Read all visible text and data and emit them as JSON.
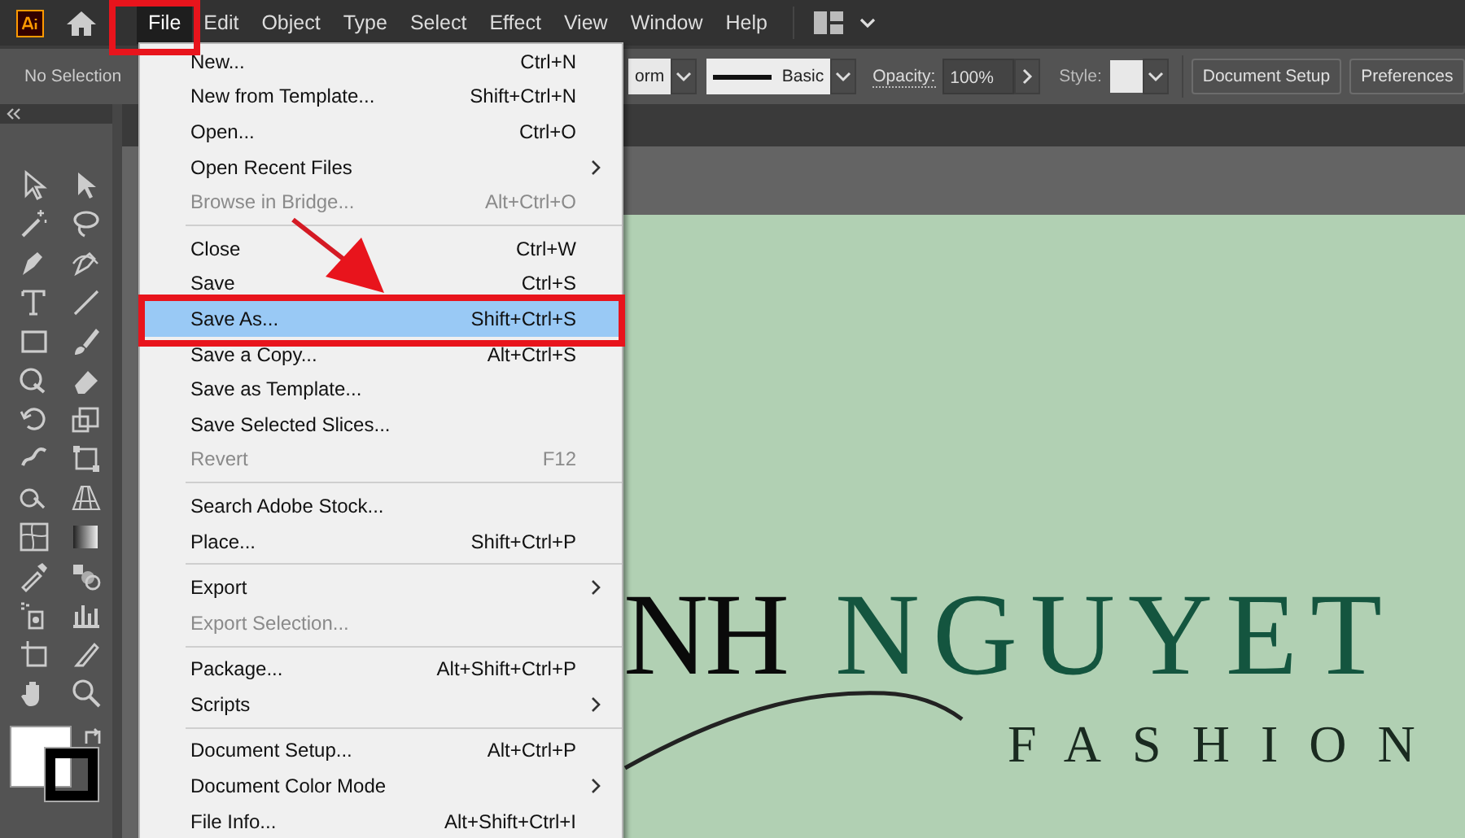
{
  "menubar": {
    "items": [
      {
        "label": "File",
        "selected": true
      },
      {
        "label": "Edit",
        "selected": false
      },
      {
        "label": "Object",
        "selected": false
      },
      {
        "label": "Type",
        "selected": false
      },
      {
        "label": "Select",
        "selected": false
      },
      {
        "label": "Effect",
        "selected": false
      },
      {
        "label": "View",
        "selected": false
      },
      {
        "label": "Window",
        "selected": false
      },
      {
        "label": "Help",
        "selected": false
      }
    ]
  },
  "control_bar": {
    "selection_label": "No Selection",
    "profile_value": "orm",
    "stroke_label": "Basic",
    "opacity_label": "Opacity:",
    "opacity_value": "100%",
    "style_label": "Style:",
    "buttons": [
      "Document Setup",
      "Preferences"
    ]
  },
  "file_menu": {
    "items": [
      {
        "kind": "item",
        "label": "New...",
        "shortcut": "Ctrl+N",
        "submenu": false,
        "disabled": false,
        "selected": false
      },
      {
        "kind": "item",
        "label": "New from Template...",
        "shortcut": "Shift+Ctrl+N",
        "submenu": false,
        "disabled": false,
        "selected": false
      },
      {
        "kind": "item",
        "label": "Open...",
        "shortcut": "Ctrl+O",
        "submenu": false,
        "disabled": false,
        "selected": false
      },
      {
        "kind": "item",
        "label": "Open Recent Files",
        "submenu": true,
        "disabled": false,
        "selected": false
      },
      {
        "kind": "item",
        "label": "Browse in Bridge...",
        "shortcut": "Alt+Ctrl+O",
        "submenu": false,
        "disabled": true,
        "selected": false
      },
      {
        "kind": "separator"
      },
      {
        "kind": "item",
        "label": "Close",
        "shortcut": "Ctrl+W",
        "submenu": false,
        "disabled": false,
        "selected": false
      },
      {
        "kind": "item",
        "label": "Save",
        "shortcut": "Ctrl+S",
        "submenu": false,
        "disabled": false,
        "selected": false
      },
      {
        "kind": "item",
        "label": "Save As...",
        "shortcut": "Shift+Ctrl+S",
        "submenu": false,
        "disabled": false,
        "selected": true
      },
      {
        "kind": "item",
        "label": "Save a Copy...",
        "shortcut": "Alt+Ctrl+S",
        "submenu": false,
        "disabled": false,
        "selected": false
      },
      {
        "kind": "item",
        "label": "Save as Template...",
        "submenu": false,
        "disabled": false,
        "selected": false
      },
      {
        "kind": "item",
        "label": "Save Selected Slices...",
        "submenu": false,
        "disabled": false,
        "selected": false
      },
      {
        "kind": "item",
        "label": "Revert",
        "shortcut": "F12",
        "submenu": false,
        "disabled": true,
        "selected": false
      },
      {
        "kind": "separator"
      },
      {
        "kind": "item",
        "label": "Search Adobe Stock...",
        "submenu": false,
        "disabled": false,
        "selected": false
      },
      {
        "kind": "item",
        "label": "Place...",
        "shortcut": "Shift+Ctrl+P",
        "submenu": false,
        "disabled": false,
        "selected": false
      },
      {
        "kind": "separator"
      },
      {
        "kind": "item",
        "label": "Export",
        "submenu": true,
        "disabled": false,
        "selected": false
      },
      {
        "kind": "item",
        "label": "Export Selection...",
        "submenu": false,
        "disabled": true,
        "selected": false
      },
      {
        "kind": "separator"
      },
      {
        "kind": "item",
        "label": "Package...",
        "shortcut": "Alt+Shift+Ctrl+P",
        "submenu": false,
        "disabled": false,
        "selected": false
      },
      {
        "kind": "item",
        "label": "Scripts",
        "submenu": true,
        "disabled": false,
        "selected": false
      },
      {
        "kind": "separator"
      },
      {
        "kind": "item",
        "label": "Document Setup...",
        "shortcut": "Alt+Ctrl+P",
        "submenu": false,
        "disabled": false,
        "selected": false
      },
      {
        "kind": "item",
        "label": "Document Color Mode",
        "submenu": true,
        "disabled": false,
        "selected": false
      },
      {
        "kind": "item",
        "label": "File Info...",
        "shortcut": "Alt+Shift+Ctrl+I",
        "submenu": false,
        "disabled": false,
        "selected": false
      }
    ]
  },
  "artboard": {
    "logo_part_1": "NH",
    "logo_part_2": "NGUYET",
    "tagline": "FASHION"
  }
}
